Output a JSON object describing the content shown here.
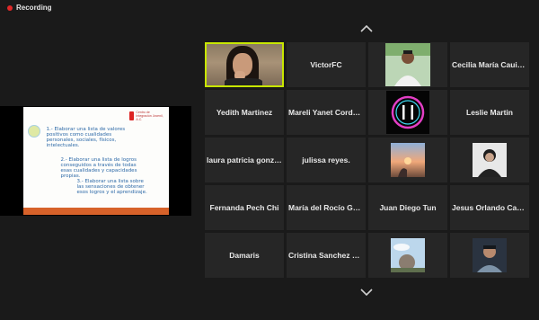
{
  "recording": {
    "label": "Recording"
  },
  "shared_slide": {
    "logo_text": "Centro de Integración Juvenil, A.C.",
    "text1": "1.- Elaborar una lista de valores positivos como cualidades personales, sociales, físicos, intelectuales.",
    "text2": "2.- Elaborar una lista de logros conseguidos a través de todas esas cualidades y capacidades propias.",
    "text3": "3.- Elaborar una lista sobre las sensaciones de obtener esos logros y el aprendizaje."
  },
  "participants": [
    {
      "type": "video",
      "icon": "participant-video",
      "active": true
    },
    {
      "type": "name",
      "name": "VictorFC"
    },
    {
      "type": "photo",
      "icon": "profile-photo-man"
    },
    {
      "type": "name",
      "name": "Cecilia María Cauich..."
    },
    {
      "type": "name",
      "name": "Yedith Martinez"
    },
    {
      "type": "name",
      "name": "Mareli Yanet Cordova..."
    },
    {
      "type": "photo",
      "icon": "profile-photo-neon-logo"
    },
    {
      "type": "name",
      "name": "Leslie Martin"
    },
    {
      "type": "name",
      "name": "laura patricia gonzale..."
    },
    {
      "type": "name",
      "name": "julissa reyes."
    },
    {
      "type": "photo",
      "icon": "profile-photo-sunset"
    },
    {
      "type": "photo",
      "icon": "profile-photo-portrait"
    },
    {
      "type": "name",
      "name": "Fernanda Pech Chi"
    },
    {
      "type": "name",
      "name": "María del Rocío Gamb..."
    },
    {
      "type": "name",
      "name": "Juan Diego Tun"
    },
    {
      "type": "name",
      "name": "Jesus Orlando Cab Lu..."
    },
    {
      "type": "name",
      "name": "Damaris"
    },
    {
      "type": "name",
      "name": "Cristina Sanchez Och..."
    },
    {
      "type": "photo",
      "icon": "profile-photo-sky"
    },
    {
      "type": "photo",
      "icon": "profile-photo-man-2"
    }
  ],
  "nav": {
    "up_icon": "chevron-up-icon",
    "down_icon": "chevron-down-icon"
  },
  "colors": {
    "background": "#1a1a1a",
    "tile": "#262626",
    "active_border": "#c8e600",
    "recording_dot": "#e02828"
  }
}
